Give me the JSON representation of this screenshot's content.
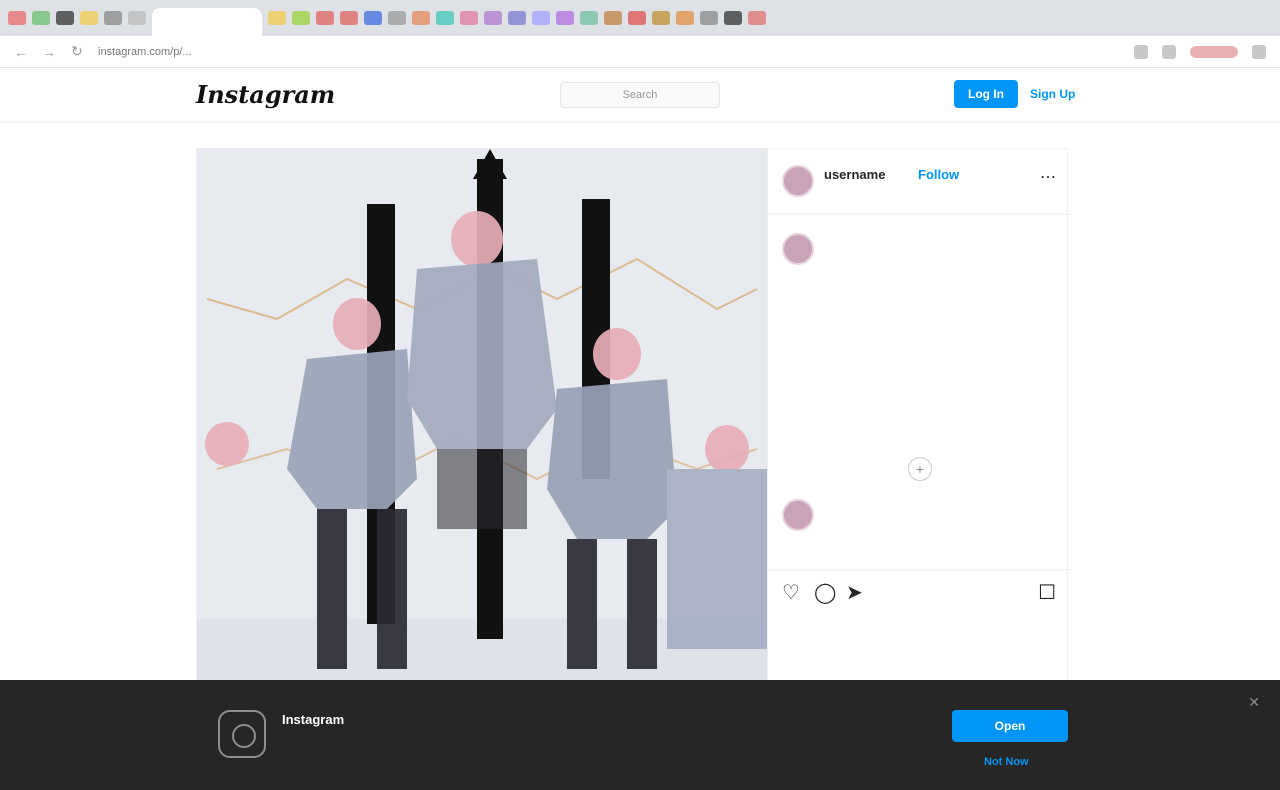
{
  "browser": {
    "url": "instagram.com/p/...",
    "tab_colors": [
      "#e96b6b",
      "#6bbf6b",
      "#333333",
      "#f2c94c",
      "#888888",
      "#bbbbbb",
      "#f2c94c",
      "#9bd13b",
      "#e06060",
      "#e06060",
      "#3d6ee0",
      "#999999",
      "#e58a5b",
      "#3dc7b5",
      "#e07aa0",
      "#b07ad0",
      "#7a7ad0",
      "#a0a0ff",
      "#b070e0",
      "#70c0a0",
      "#c08040",
      "#e05050",
      "#c09030",
      "#e09040",
      "#888888",
      "#333333",
      "#e07070"
    ],
    "back_icon": "arrow-left-icon",
    "forward_icon": "arrow-right-icon",
    "reload_icon": "reload-icon"
  },
  "header": {
    "logo": "Instagram",
    "search_placeholder": "Search",
    "login_label": "Log In",
    "signup_label": "Sign Up"
  },
  "post": {
    "username": "username",
    "follow_label": "Follow",
    "more_icon": "more-icon",
    "caption": "",
    "hashtags": "",
    "caption_time": "",
    "comment": "",
    "comment_meta": "",
    "likes": "",
    "date": ""
  },
  "banner": {
    "title": "Instagram",
    "text": "",
    "open_label": "Open",
    "not_now_label": "Not Now",
    "close_icon": "close-icon"
  }
}
